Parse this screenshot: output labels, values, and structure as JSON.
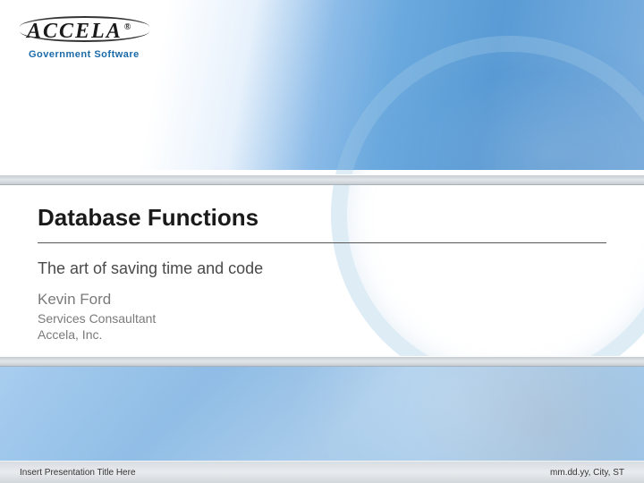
{
  "logo": {
    "brand": "ACCELA",
    "reg": "®",
    "tagline": "Government Software"
  },
  "slide": {
    "title": "Database Functions",
    "subtitle": "The art of saving time and code",
    "author": "Kevin Ford",
    "role": "Services Consaultant",
    "company": "Accela, Inc."
  },
  "footer": {
    "left": "Insert Presentation Title Here",
    "right": "mm.dd.yy, City, ST"
  }
}
